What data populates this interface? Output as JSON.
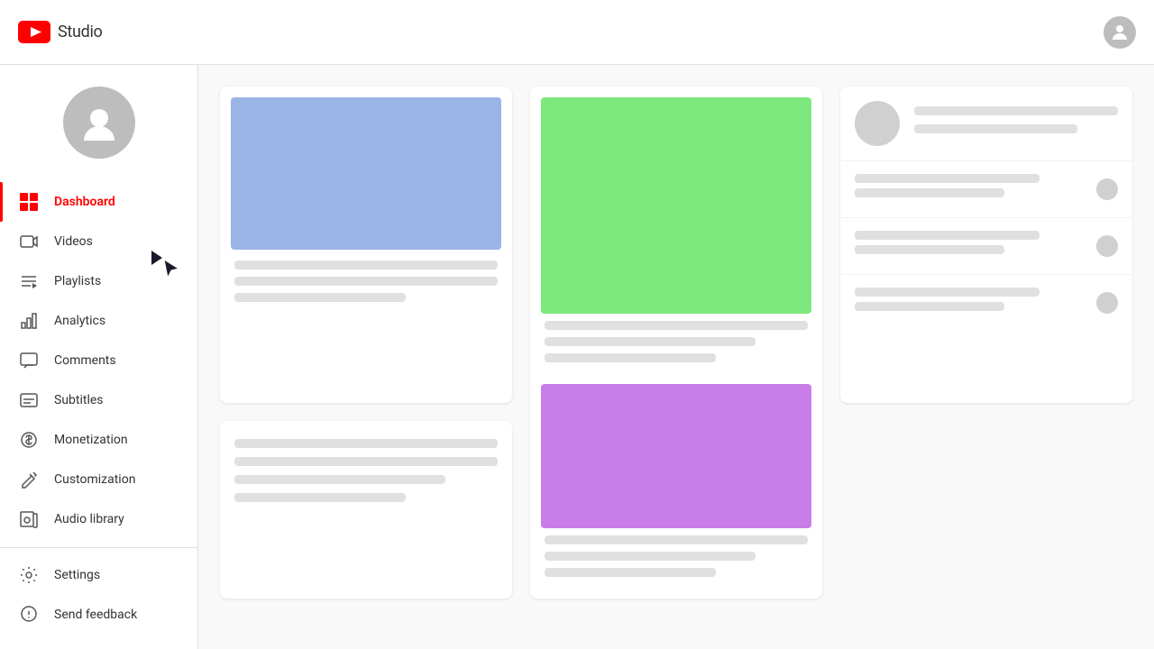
{
  "header": {
    "logo_text": "Studio",
    "avatar_label": "User account"
  },
  "sidebar": {
    "nav_items": [
      {
        "id": "dashboard",
        "label": "Dashboard",
        "icon": "⊞",
        "active": true
      },
      {
        "id": "videos",
        "label": "Videos",
        "icon": "▶",
        "active": false
      },
      {
        "id": "playlists",
        "label": "Playlists",
        "icon": "≡",
        "active": false
      },
      {
        "id": "analytics",
        "label": "Analytics",
        "icon": "▦",
        "active": false
      },
      {
        "id": "comments",
        "label": "Comments",
        "icon": "⊟",
        "active": false
      },
      {
        "id": "subtitles",
        "label": "Subtitles",
        "icon": "⊟",
        "active": false
      },
      {
        "id": "monetization",
        "label": "Monetization",
        "icon": "$",
        "active": false
      },
      {
        "id": "customization",
        "label": "Customization",
        "icon": "✏",
        "active": false
      },
      {
        "id": "audio-library",
        "label": "Audio library",
        "icon": "⊟",
        "active": false
      }
    ],
    "bottom_items": [
      {
        "id": "settings",
        "label": "Settings",
        "icon": "⚙"
      },
      {
        "id": "send-feedback",
        "label": "Send feedback",
        "icon": "⚑"
      }
    ]
  },
  "main": {
    "cards": [
      {
        "id": "card1",
        "thumbnail_color": "#9ab4e8"
      },
      {
        "id": "card2-top",
        "thumbnail_color": "#7de87d"
      },
      {
        "id": "card2-bottom",
        "thumbnail_color": "#c87de8"
      },
      {
        "id": "card3"
      },
      {
        "id": "card4"
      },
      {
        "id": "card5"
      }
    ]
  }
}
